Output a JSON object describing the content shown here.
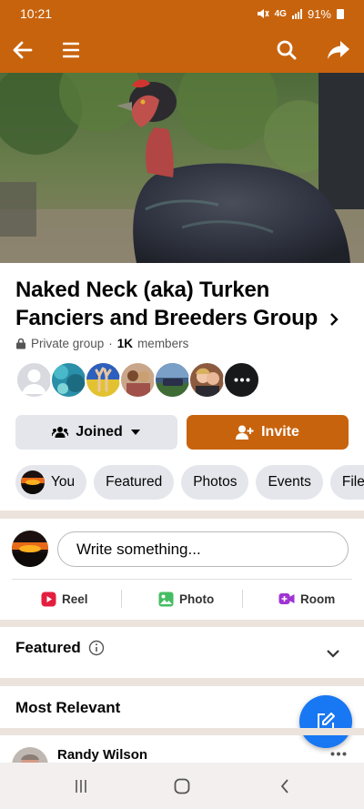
{
  "status_bar": {
    "time": "10:21",
    "network": "4G",
    "battery": "91%"
  },
  "topbar": {
    "accent_color": "#c8630d",
    "icons": [
      "back-arrow-icon",
      "menu-icon",
      "search-icon",
      "share-icon"
    ]
  },
  "group": {
    "name": "Naked Neck (aka) Turken Fanciers and Breeders Group",
    "privacy": "Private group",
    "separator": "·",
    "member_count": "1K",
    "member_label": "members",
    "actions": {
      "joined_label": "Joined",
      "invite_label": "Invite"
    }
  },
  "tabs": [
    {
      "label": "You"
    },
    {
      "label": "Featured"
    },
    {
      "label": "Photos"
    },
    {
      "label": "Events"
    },
    {
      "label": "Files"
    }
  ],
  "composer": {
    "placeholder": "Write something...",
    "post_types": [
      {
        "label": "Reel",
        "icon": "reel-icon",
        "color": "#e41e3f"
      },
      {
        "label": "Photo",
        "icon": "photo-icon",
        "color": "#45bd62"
      },
      {
        "label": "Room",
        "icon": "room-icon",
        "color": "#a033d4"
      }
    ]
  },
  "sections": {
    "featured_label": "Featured",
    "sort_label": "Most Relevant"
  },
  "post": {
    "author": "Randy Wilson"
  },
  "fab_color": "#1877f2"
}
